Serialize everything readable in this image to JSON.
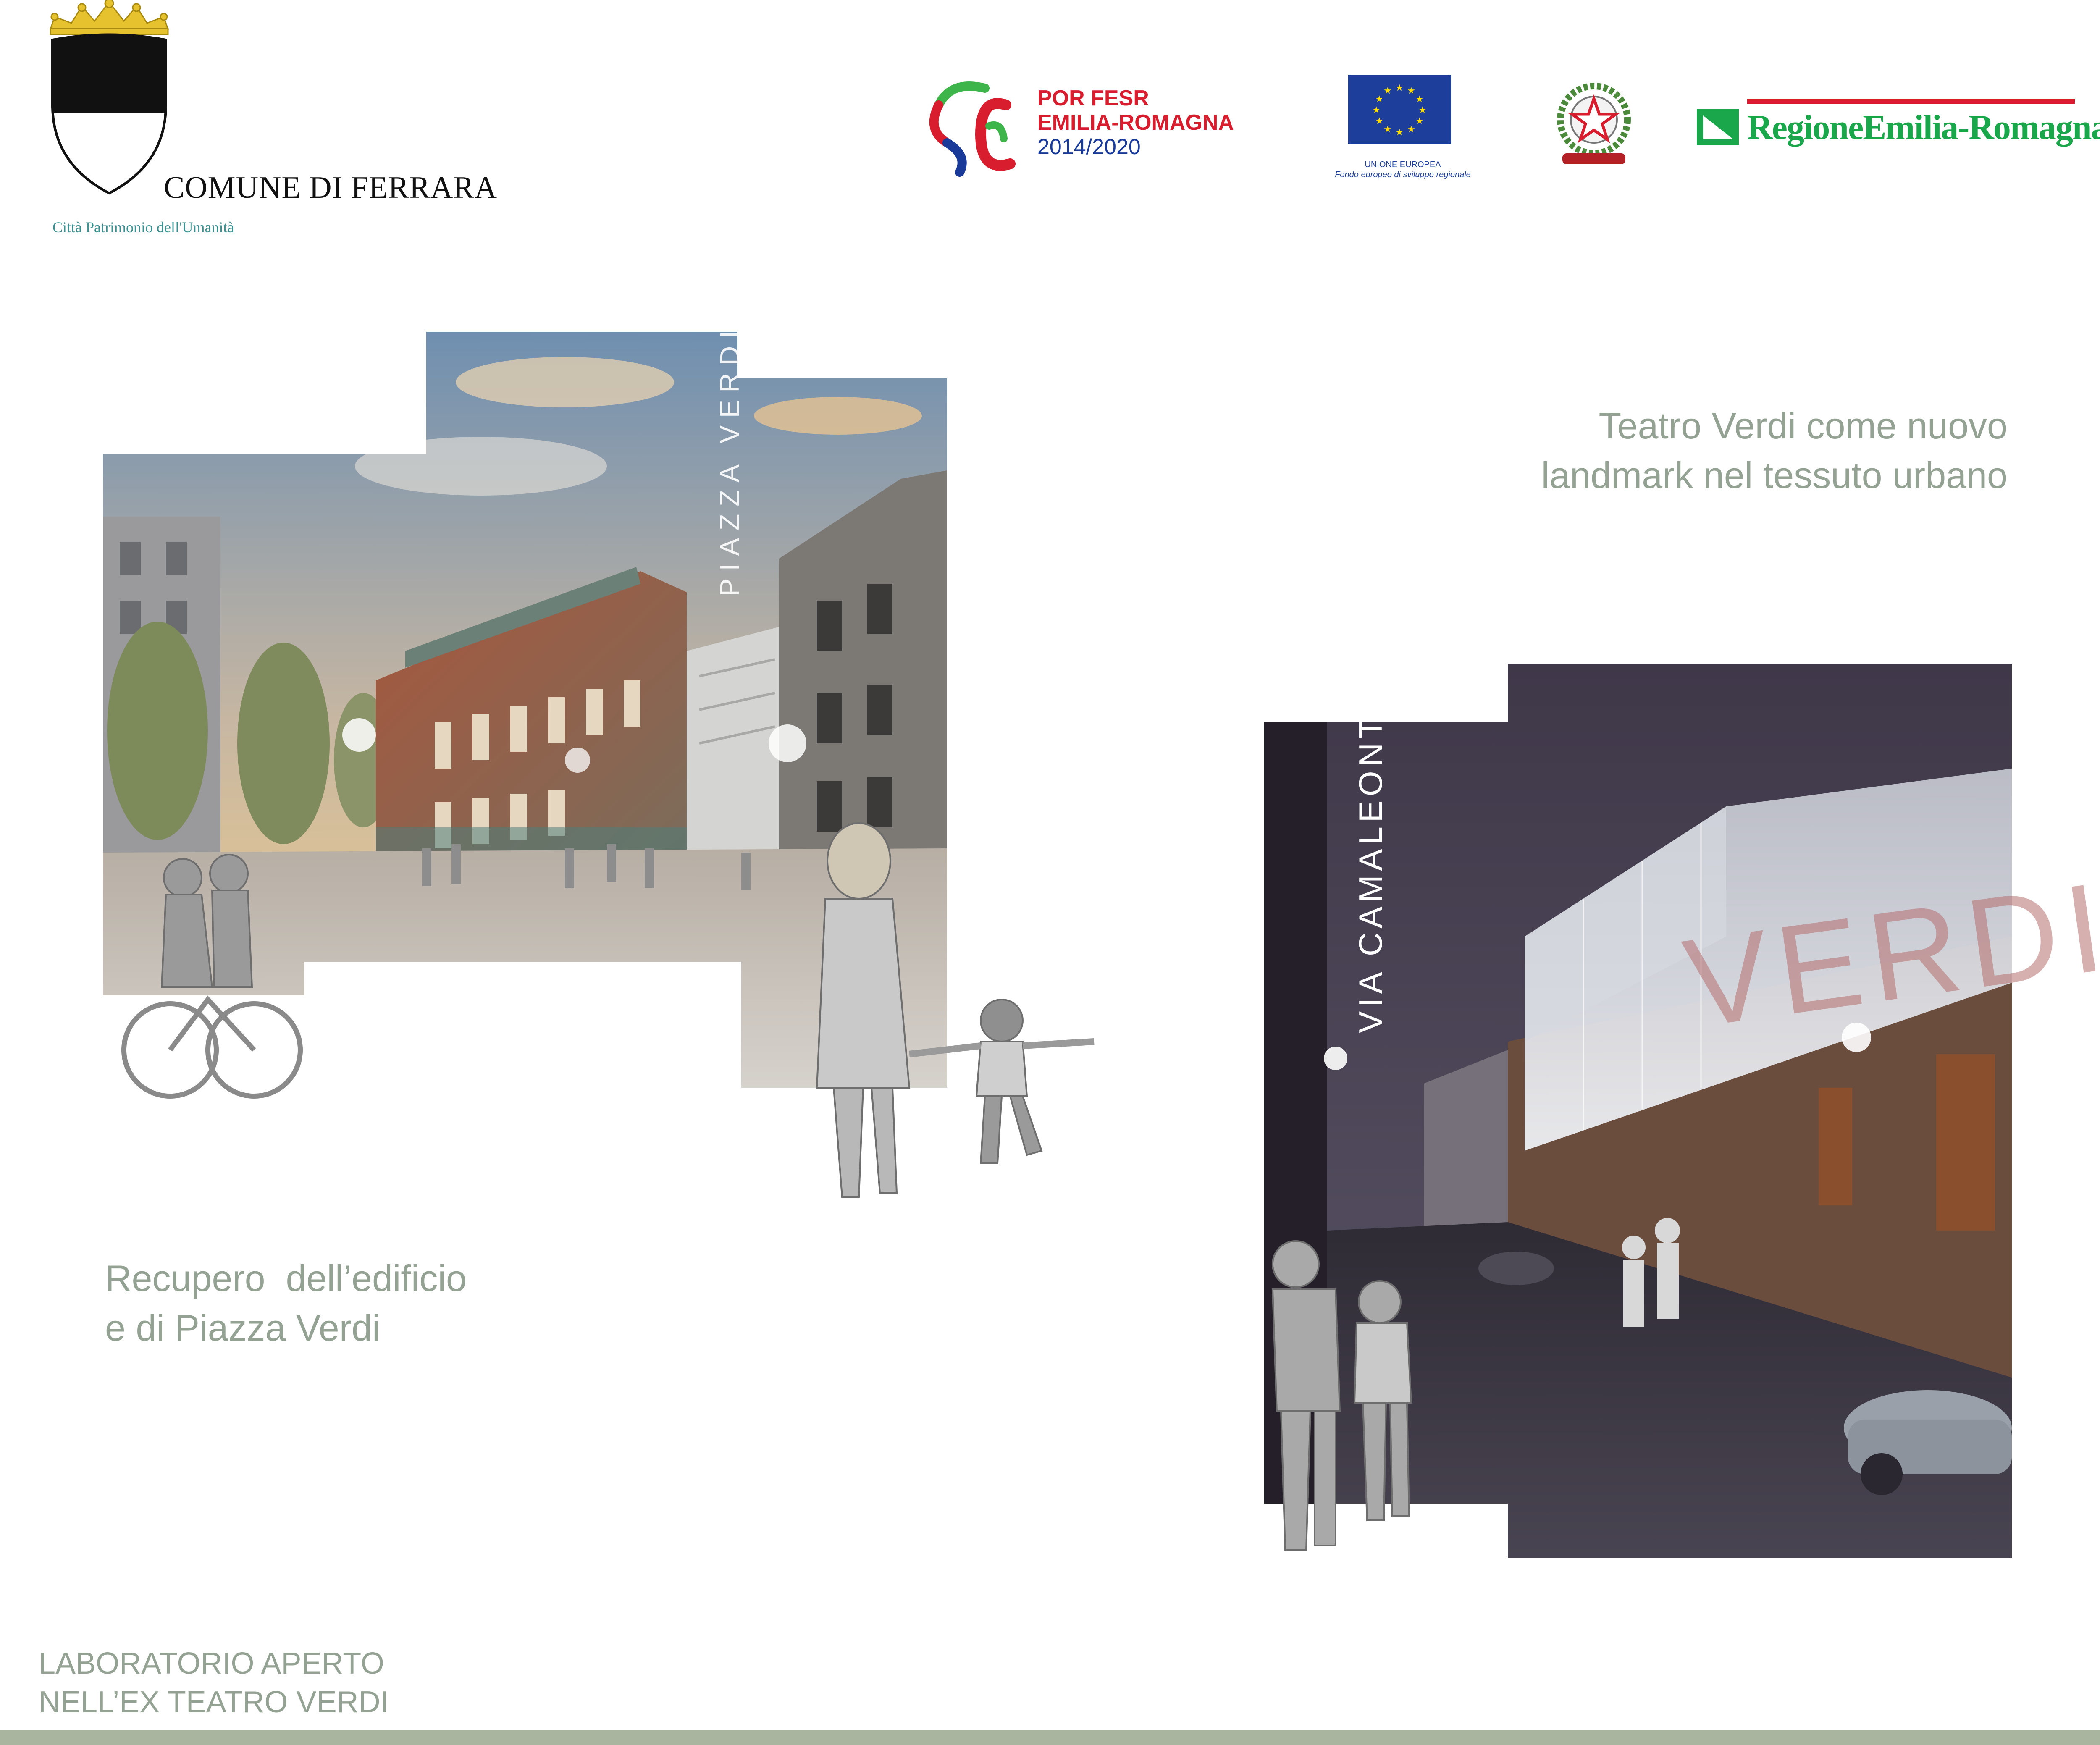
{
  "header": {
    "comune_name": "COMUNE DI FERRARA",
    "comune_tagline": "Città Patrimonio dell'Umanità",
    "porfesr_line1": "POR FESR",
    "porfesr_line2": "EMILIA-ROMAGNA",
    "porfesr_years": "2014/2020",
    "eu_caption_line1": "UNIONE EUROPEA",
    "eu_caption_line2": "Fondo europeo di sviluppo regionale",
    "regione_name": "RegioneEmilia-Romagna"
  },
  "renders": {
    "piazza_label": "PIAZZA VERDI",
    "night_street_label": "VIA CAMALEONTE",
    "facade_sign": "VERDI"
  },
  "captions": {
    "landmark_line1": "Teatro Verdi come nuovo",
    "landmark_line2": "landmark nel tessuto urbano",
    "recupero_line1": "Recupero  dell’edificio",
    "recupero_line2": "e di Piazza Verdi"
  },
  "footer": {
    "line1": "LABORATORIO APERTO",
    "line2": "NELL’EX TEATRO VERDI"
  },
  "colors": {
    "caption_green": "#93a292",
    "porfesr_red": "#d71d2e",
    "eu_blue": "#1d3f9b",
    "regione_green": "#1aa64a",
    "comune_teal": "#3a8f8f",
    "footer_bar": "#a9b59f"
  }
}
